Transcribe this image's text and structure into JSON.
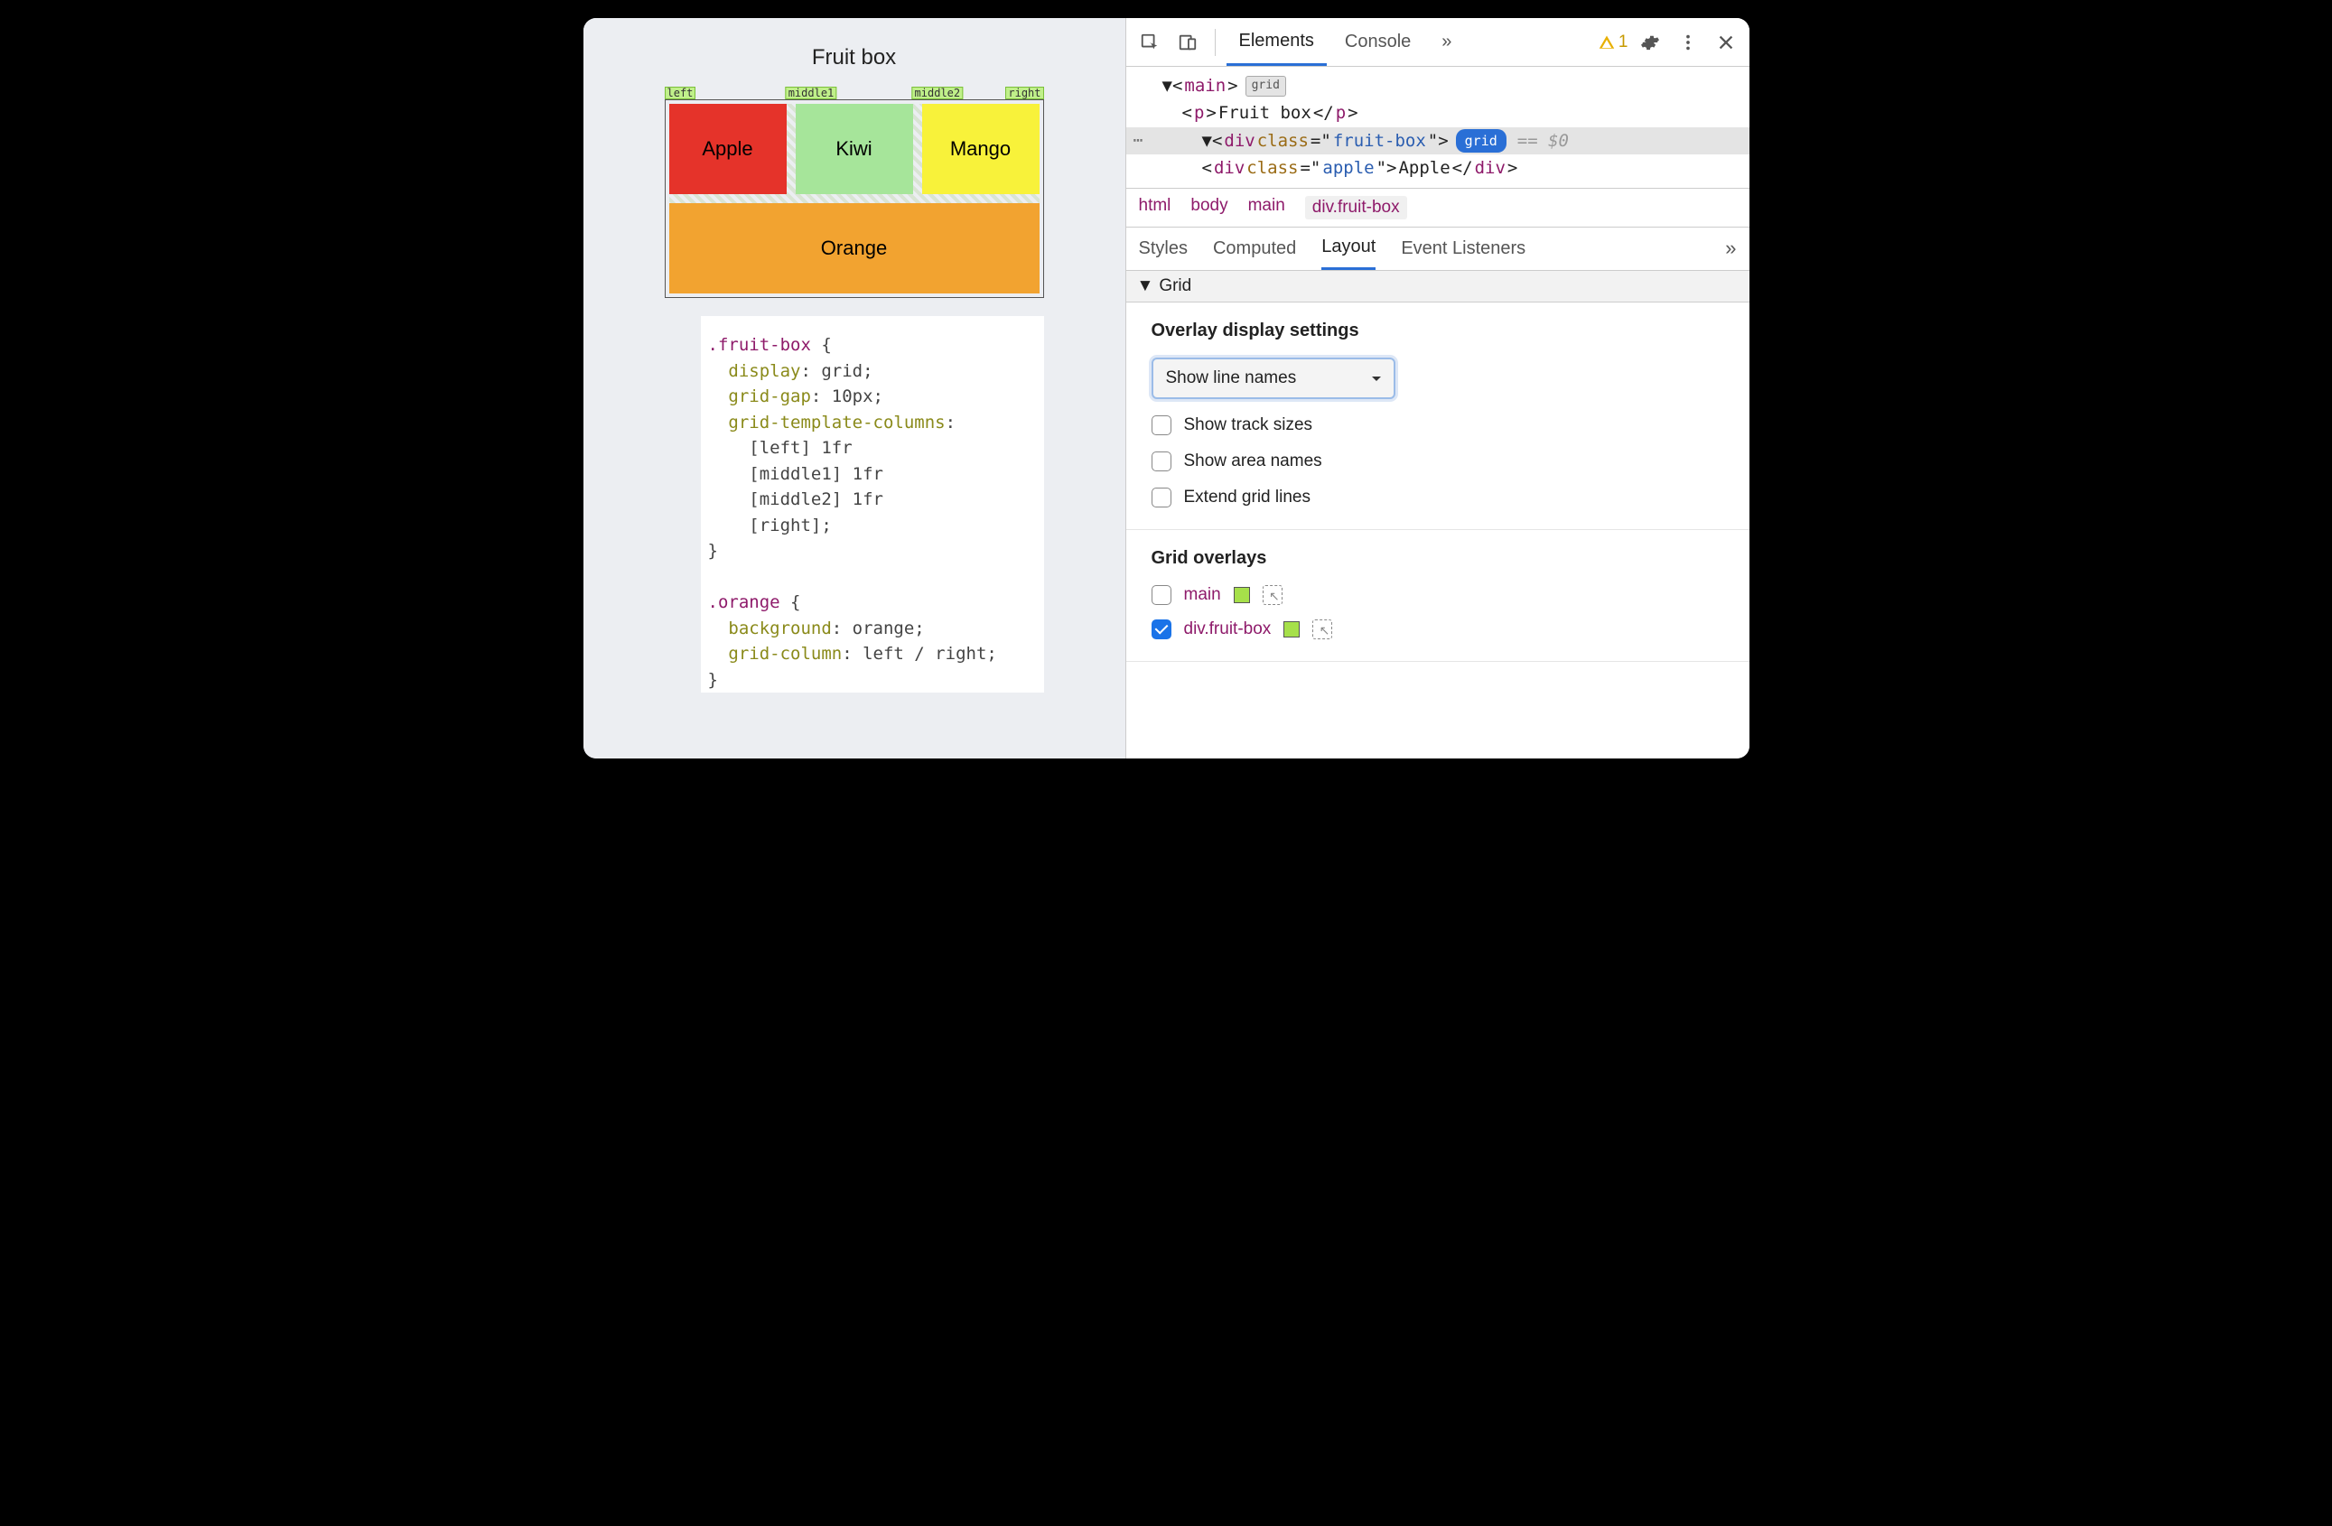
{
  "viewport": {
    "title": "Fruit box",
    "line_labels": [
      "left",
      "middle1",
      "middle2",
      "right"
    ],
    "cells": {
      "apple": "Apple",
      "kiwi": "Kiwi",
      "mango": "Mango",
      "orange": "Orange"
    },
    "css": ".fruit-box {\n  display: grid;\n  grid-gap: 10px;\n  grid-template-columns:\n    [left] 1fr\n    [middle1] 1fr\n    [middle2] 1fr\n    [right];\n}\n\n.orange {\n  background: orange;\n  grid-column: left / right;\n}"
  },
  "toolbar": {
    "tabs": {
      "elements": "Elements",
      "console": "Console"
    },
    "more": "»",
    "warning_count": "1"
  },
  "dom": {
    "main_open": "main",
    "main_badge": "grid",
    "p_text": "Fruit box",
    "div_class": "fruit-box",
    "div_badge": "grid",
    "trail": "== $0",
    "child_class": "apple",
    "child_text": "Apple"
  },
  "breadcrumbs": [
    "html",
    "body",
    "main",
    "div.fruit-box"
  ],
  "panel_tabs": [
    "Styles",
    "Computed",
    "Layout",
    "Event Listeners"
  ],
  "panel_more": "»",
  "section": {
    "title": "Grid",
    "overlay_heading": "Overlay display settings",
    "dropdown": "Show line names",
    "checks": {
      "track": "Show track sizes",
      "area": "Show area names",
      "extend": "Extend grid lines"
    },
    "overlays_heading": "Grid overlays",
    "overlays": {
      "main": {
        "label": "main",
        "color": "#a6e04a",
        "checked": false
      },
      "fruit": {
        "label": "div.fruit-box",
        "color": "#a6e04a",
        "checked": true
      }
    }
  }
}
